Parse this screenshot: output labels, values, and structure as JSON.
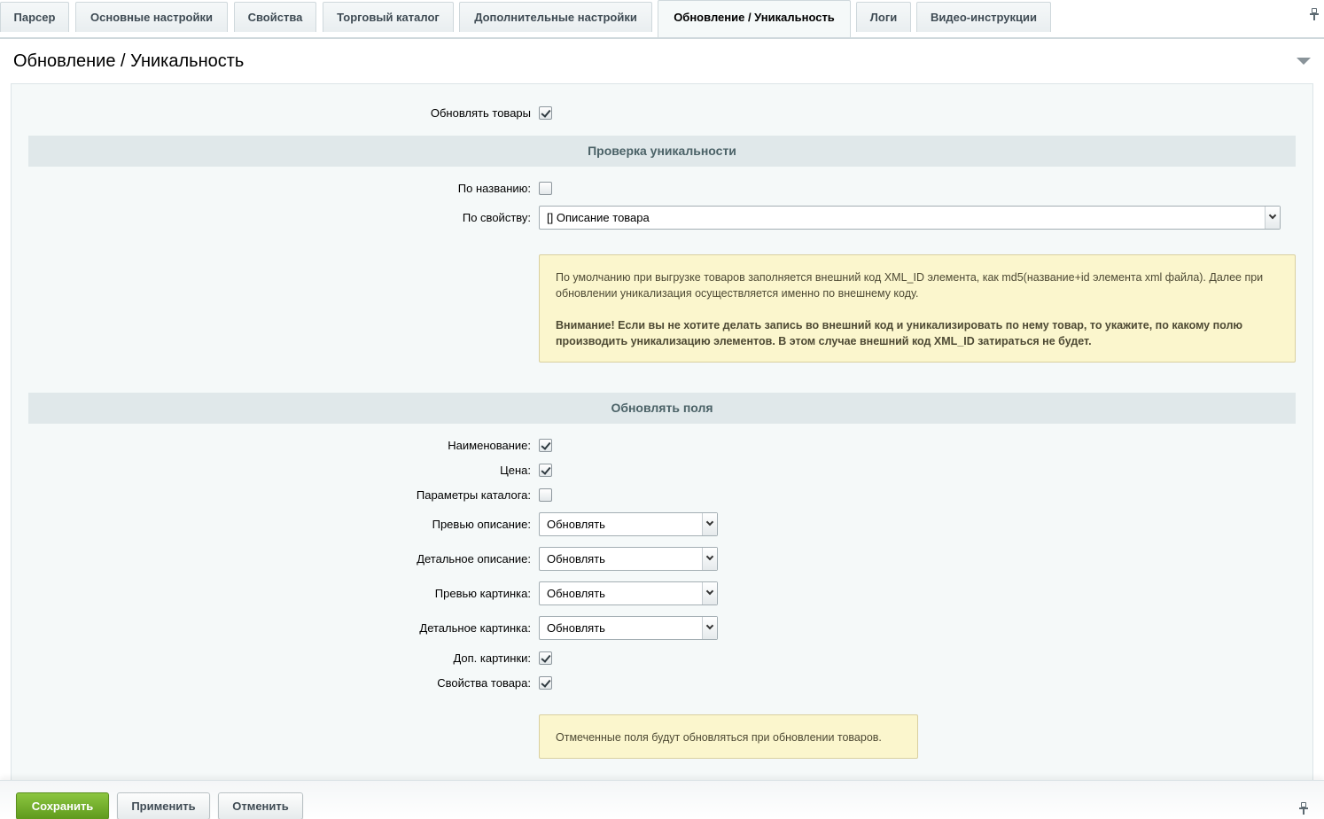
{
  "tabs": [
    {
      "label": "Парсер"
    },
    {
      "label": "Основные настройки"
    },
    {
      "label": "Свойства"
    },
    {
      "label": "Торговый каталог"
    },
    {
      "label": "Дополнительные настройки"
    },
    {
      "label": "Обновление / Уникальность",
      "active": true
    },
    {
      "label": "Логи"
    },
    {
      "label": "Видео-инструкции"
    }
  ],
  "page_title": "Обновление / Уникальность",
  "update_goods": {
    "label": "Обновлять товары",
    "checked": true
  },
  "uniqueness": {
    "section_title": "Проверка уникальности",
    "by_name": {
      "label": "По названию:",
      "checked": false
    },
    "by_property": {
      "label": "По свойству:",
      "value": "[] Описание товара"
    },
    "note_text": "По умолчанию при выгрузке товаров заполняется внешний код XML_ID элемента, как md5(название+id элемента xml файла). Далее при обновлении уникализация осуществляется именно по внешнему коду.",
    "note_warning": "Внимание! Если вы не хотите делать запись во внешний код и уникализировать по нему товар, то укажите, по какому полю производить уникализацию элементов. В этом случае внешний код XML_ID затираться не будет."
  },
  "update_fields": {
    "section_title": "Обновлять поля",
    "name": {
      "label": "Наименование:",
      "checked": true
    },
    "price": {
      "label": "Цена:",
      "checked": true
    },
    "catalog_params": {
      "label": "Параметры каталога:",
      "checked": false
    },
    "preview_text": {
      "label": "Превью описание:",
      "value": "Обновлять"
    },
    "detail_text": {
      "label": "Детальное описание:",
      "value": "Обновлять"
    },
    "preview_picture": {
      "label": "Превью картинка:",
      "value": "Обновлять"
    },
    "detail_picture": {
      "label": "Детальное картинка:",
      "value": "Обновлять"
    },
    "more_pictures": {
      "label": "Доп. картинки:",
      "checked": true
    },
    "properties": {
      "label": "Свойства товара:",
      "checked": true
    },
    "note_text": "Отмеченные поля будут обновляться при обновлении товаров."
  },
  "footer": {
    "save": "Сохранить",
    "apply": "Применить",
    "cancel": "Отменить"
  },
  "colors": {
    "primary_button": "#6aa526",
    "section_bg": "#e0e8ea",
    "note_bg": "#fbf6cd"
  }
}
